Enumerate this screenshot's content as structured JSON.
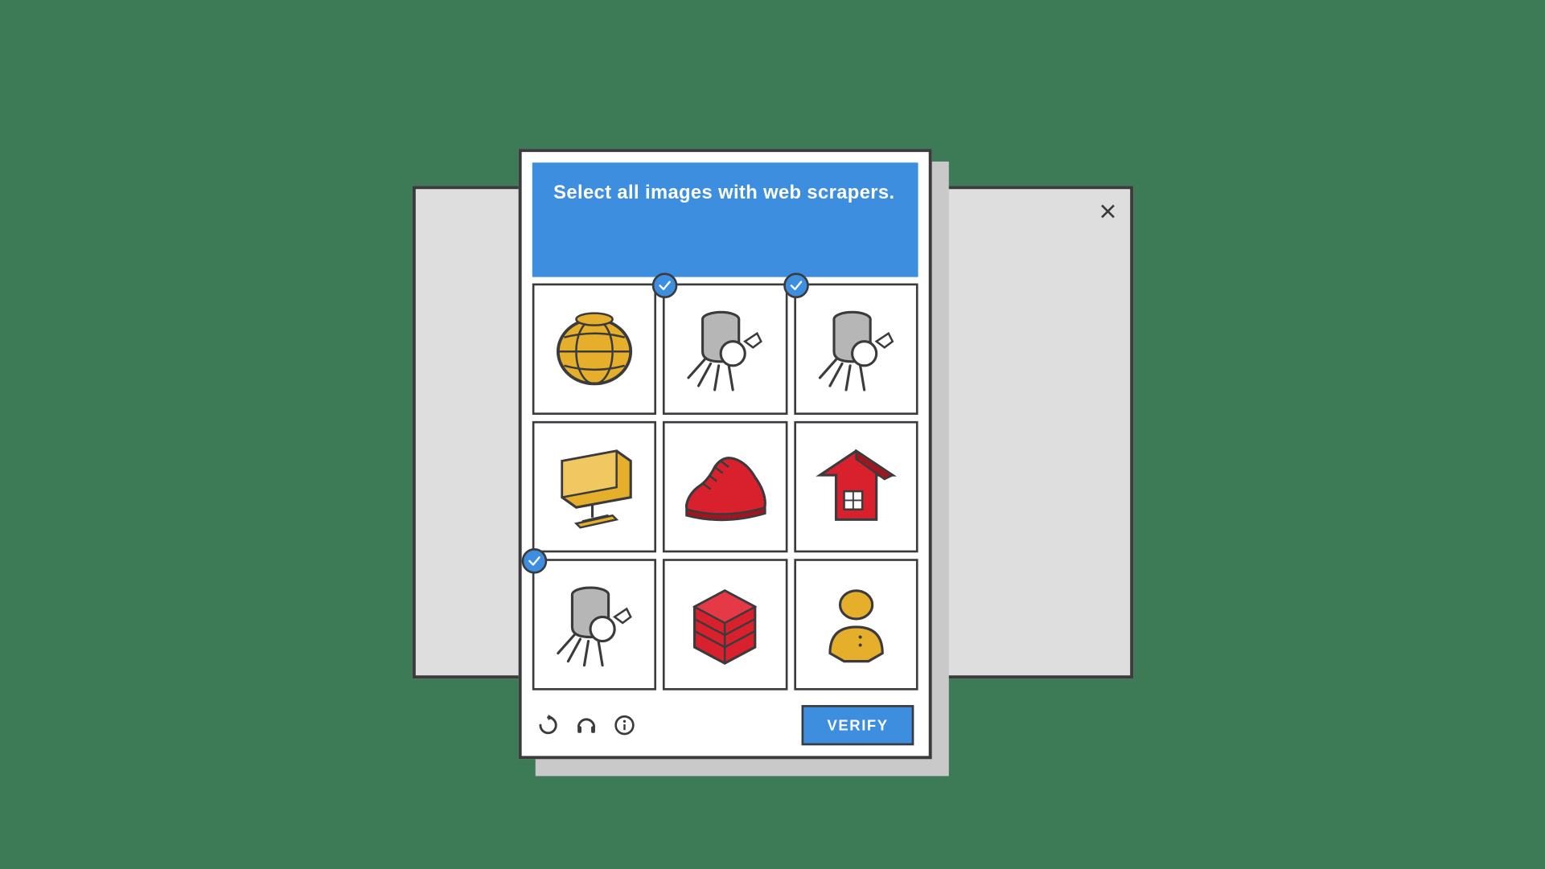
{
  "captcha": {
    "instruction": "Select all images with web scrapers.",
    "verify_label": "VERIFY",
    "tiles": [
      {
        "kind": "globe",
        "selected": false
      },
      {
        "kind": "scraper",
        "selected": true
      },
      {
        "kind": "scraper",
        "selected": true
      },
      {
        "kind": "monitor",
        "selected": false
      },
      {
        "kind": "shoe",
        "selected": false
      },
      {
        "kind": "house",
        "selected": false
      },
      {
        "kind": "scraper",
        "selected": true
      },
      {
        "kind": "server",
        "selected": false
      },
      {
        "kind": "user",
        "selected": false
      }
    ],
    "footer_icons": [
      "refresh",
      "headphones",
      "info"
    ]
  },
  "colors": {
    "accent": "#3e8ee0",
    "outline": "#3b3a3d",
    "yellow": "#e5af2c",
    "red": "#d9212e",
    "grey": "#b6b6b6",
    "page_bg": "#3d7a56"
  }
}
